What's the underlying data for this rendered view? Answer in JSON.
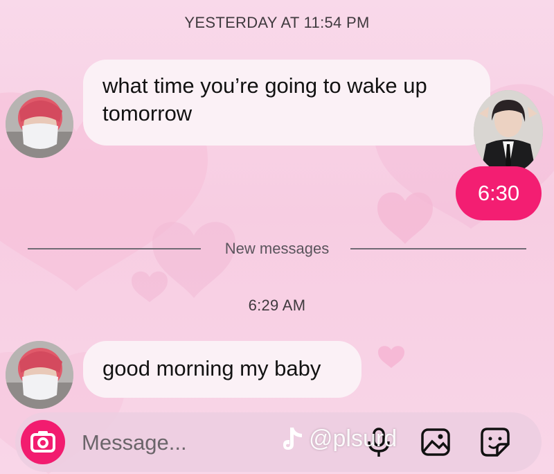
{
  "header": {
    "timestamp": "YESTERDAY AT 11:54 PM"
  },
  "messages": [
    {
      "from": "contact",
      "text": "what time you’re going to wake up tomorrow"
    },
    {
      "from": "me",
      "text": "6:30"
    }
  ],
  "divider": {
    "label": "New messages"
  },
  "second_group": {
    "timestamp": "6:29 AM",
    "messages": [
      {
        "from": "contact",
        "text": "good morning my baby"
      }
    ]
  },
  "composer": {
    "placeholder": "Message...",
    "icons": [
      "camera-icon",
      "microphone-icon",
      "gallery-icon",
      "sticker-icon"
    ]
  },
  "watermark": {
    "text": "@plsurd",
    "icon": "tiktok-icon"
  },
  "colors": {
    "background": "#f8d4e6",
    "outgoing_bubble": "#f31e72",
    "incoming_bubble": "#fbf1f6",
    "camera_button": "#f21c6f"
  }
}
